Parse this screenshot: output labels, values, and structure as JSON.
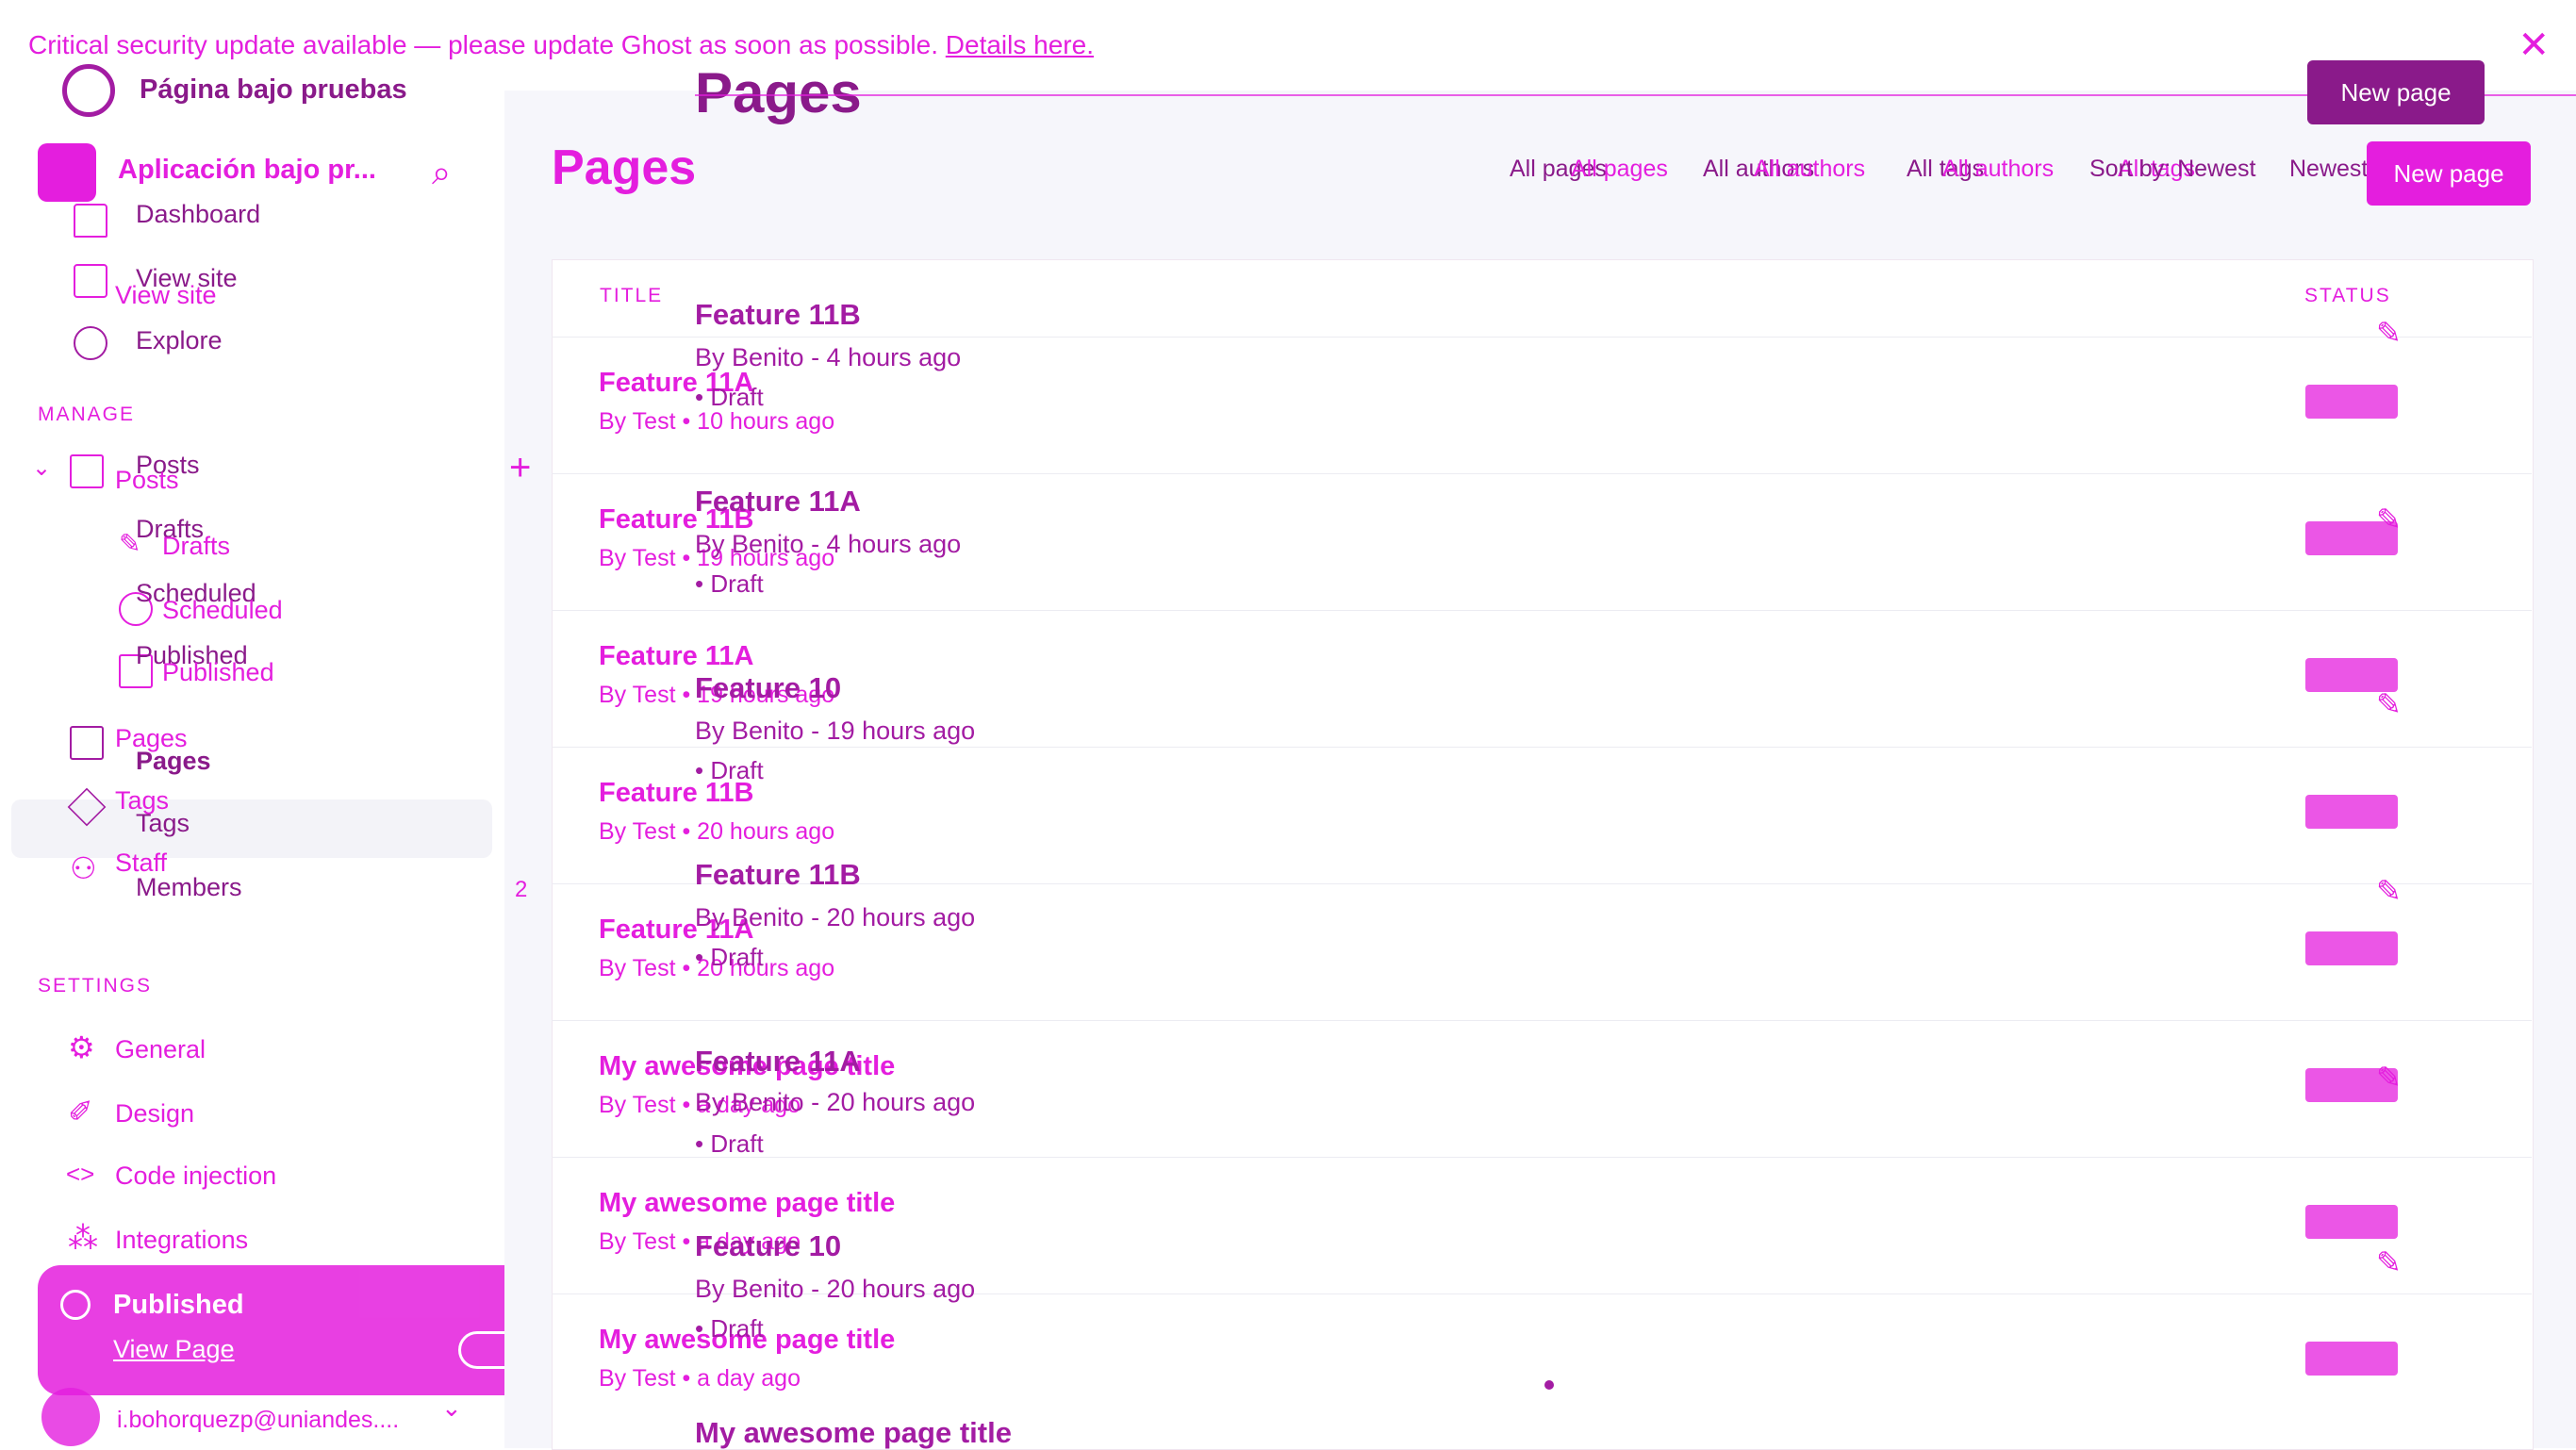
{
  "banner": {
    "text": "Critical security update available — please update Ghost as soon as possible.",
    "link": "Details here."
  },
  "sidebar": {
    "site_name": "Página bajo pruebas",
    "site_name_overlay": "Aplicación bajo pr...",
    "items_top": [
      "Dashboard",
      "View site",
      "View site",
      "Explore"
    ],
    "manage_label": "MANAGE",
    "manage": {
      "posts": "Posts",
      "drafts": "Drafts",
      "scheduled": "Scheduled",
      "published": "Published",
      "pages": "Pages",
      "tags": "Tags",
      "staff": "Staff",
      "members": "Members"
    },
    "settings_label": "SETTINGS",
    "settings": [
      "General",
      "Design",
      "Code injection",
      "Integrations"
    ],
    "user_email": "i.bohorquezp@uniandes...."
  },
  "header": {
    "title": "Pages",
    "overlay_title": "Pages",
    "filters": [
      "All pages",
      "All authors",
      "All tags",
      "Sort by: Newest"
    ],
    "filters_overlay": [
      "All pages",
      "All authors",
      "All authors",
      "All tags",
      "Newest"
    ],
    "new_page": "New page",
    "new_page_overlay": "New page"
  },
  "table": {
    "col_title": "TITLE",
    "col_status": "STATUS",
    "rows": [
      {
        "title": "Feature 11A",
        "meta": "By Test • 10 hours ago"
      },
      {
        "title": "Feature 11B",
        "meta": "By Test • 19 hours ago"
      },
      {
        "title": "Feature 11A",
        "meta": "By Test • 19 hours ago"
      },
      {
        "title": "Feature 11B",
        "meta": "By Test • 20 hours ago"
      },
      {
        "title": "Feature 11A",
        "meta": "By Test • 20 hours ago"
      },
      {
        "title": "My awesome page title",
        "meta": "By Test • a day ago"
      },
      {
        "title": "My awesome page title",
        "meta": "By Test • a day ago"
      },
      {
        "title": "My awesome page title",
        "meta": "By Test • a day ago"
      }
    ],
    "overlay_rows": [
      {
        "title": "Feature 11B",
        "meta": "By Benito - 4 hours ago",
        "status": "Draft"
      },
      {
        "title": "Feature 11A",
        "meta": "By Benito - 4 hours ago",
        "status": "Draft"
      },
      {
        "title": "Feature 10",
        "meta": "By Benito - 19 hours ago",
        "status": "Draft"
      },
      {
        "title": "Feature 11B",
        "meta": "By Benito - 20 hours ago",
        "status": "Draft"
      },
      {
        "title": "Feature 11A",
        "meta": "By Benito - 20 hours ago",
        "status": "Draft"
      },
      {
        "title": "Feature 10",
        "meta": "By Benito - 20 hours ago",
        "status": "Draft"
      },
      {
        "title": "My awesome page title",
        "meta": "",
        "status": ""
      }
    ]
  },
  "gutter": {
    "marker": "2"
  },
  "toast": {
    "title": "Published",
    "link": "View Page"
  },
  "colors": {
    "accent": "#e41ede",
    "dark": "#8a1a8a"
  }
}
